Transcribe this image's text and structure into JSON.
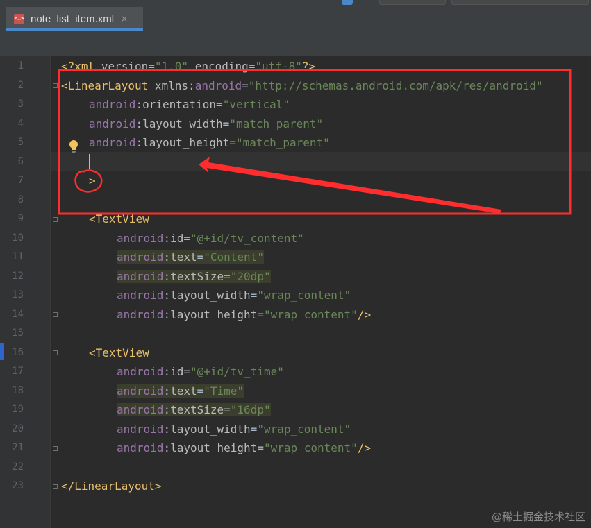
{
  "tab": {
    "label": "note_list_item.xml",
    "close_glyph": "×",
    "icon": "xml-file-icon"
  },
  "gutter": {
    "line_numbers": [
      "1",
      "2",
      "3",
      "4",
      "5",
      "6",
      "7",
      "8",
      "9",
      "10",
      "11",
      "12",
      "13",
      "14",
      "15",
      "16",
      "17",
      "18",
      "19",
      "20",
      "21",
      "22",
      "23"
    ]
  },
  "code": {
    "l1": {
      "open": "<?",
      "tag": "xml",
      "a1": "version",
      "eq1": "=",
      "v1": "\"1.0\"",
      "a2": "encoding",
      "eq2": "=",
      "v2": "\"utf-8\"",
      "close": "?>"
    },
    "l2": {
      "open": "<",
      "tag": "LinearLayout",
      "ns": "xmlns",
      "colon": ":",
      "attr": "android",
      "eq": "=",
      "val": "\"http://schemas.android.com/apk/res/android\""
    },
    "l3": {
      "ns": "android",
      "colon": ":",
      "attr": "orientation",
      "eq": "=",
      "val": "\"vertical\""
    },
    "l4": {
      "ns": "android",
      "colon": ":",
      "attr": "layout_width",
      "eq": "=",
      "val": "\"match_parent\""
    },
    "l5": {
      "ns": "android",
      "colon": ":",
      "attr": "layout_height",
      "eq": "=",
      "val": "\"match_parent\""
    },
    "l7": {
      "close": ">"
    },
    "l9": {
      "open": "<",
      "tag": "TextView"
    },
    "l10": {
      "ns": "android",
      "colon": ":",
      "attr": "id",
      "eq": "=",
      "val": "\"@+id/tv_content\""
    },
    "l11": {
      "ns": "android",
      "colon": ":",
      "attr": "text",
      "eq": "=",
      "val": "\"Content\""
    },
    "l12": {
      "ns": "android",
      "colon": ":",
      "attr": "textSize",
      "eq": "=",
      "val": "\"20dp\""
    },
    "l13": {
      "ns": "android",
      "colon": ":",
      "attr": "layout_width",
      "eq": "=",
      "val": "\"wrap_content\""
    },
    "l14": {
      "ns": "android",
      "colon": ":",
      "attr": "layout_height",
      "eq": "=",
      "val": "\"wrap_content\"",
      "close": "/>"
    },
    "l16": {
      "open": "<",
      "tag": "TextView"
    },
    "l17": {
      "ns": "android",
      "colon": ":",
      "attr": "id",
      "eq": "=",
      "val": "\"@+id/tv_time\""
    },
    "l18": {
      "ns": "android",
      "colon": ":",
      "attr": "text",
      "eq": "=",
      "val": "\"Time\""
    },
    "l19": {
      "ns": "android",
      "colon": ":",
      "attr": "textSize",
      "eq": "=",
      "val": "\"16dp\""
    },
    "l20": {
      "ns": "android",
      "colon": ":",
      "attr": "layout_width",
      "eq": "=",
      "val": "\"wrap_content\""
    },
    "l21": {
      "ns": "android",
      "colon": ":",
      "attr": "layout_height",
      "eq": "=",
      "val": "\"wrap_content\"",
      "close": "/>"
    },
    "l23": {
      "open": "</",
      "tag": "LinearLayout",
      "close": ">"
    }
  },
  "icons": {
    "bulb": "lightbulb-icon"
  },
  "colors": {
    "annotation": "#ff2d2d",
    "tag": "#e8bf6a",
    "value": "#6a8759",
    "namespace": "#9876aa",
    "background": "#2b2b2b"
  },
  "watermark": "@稀土掘金技术社区"
}
